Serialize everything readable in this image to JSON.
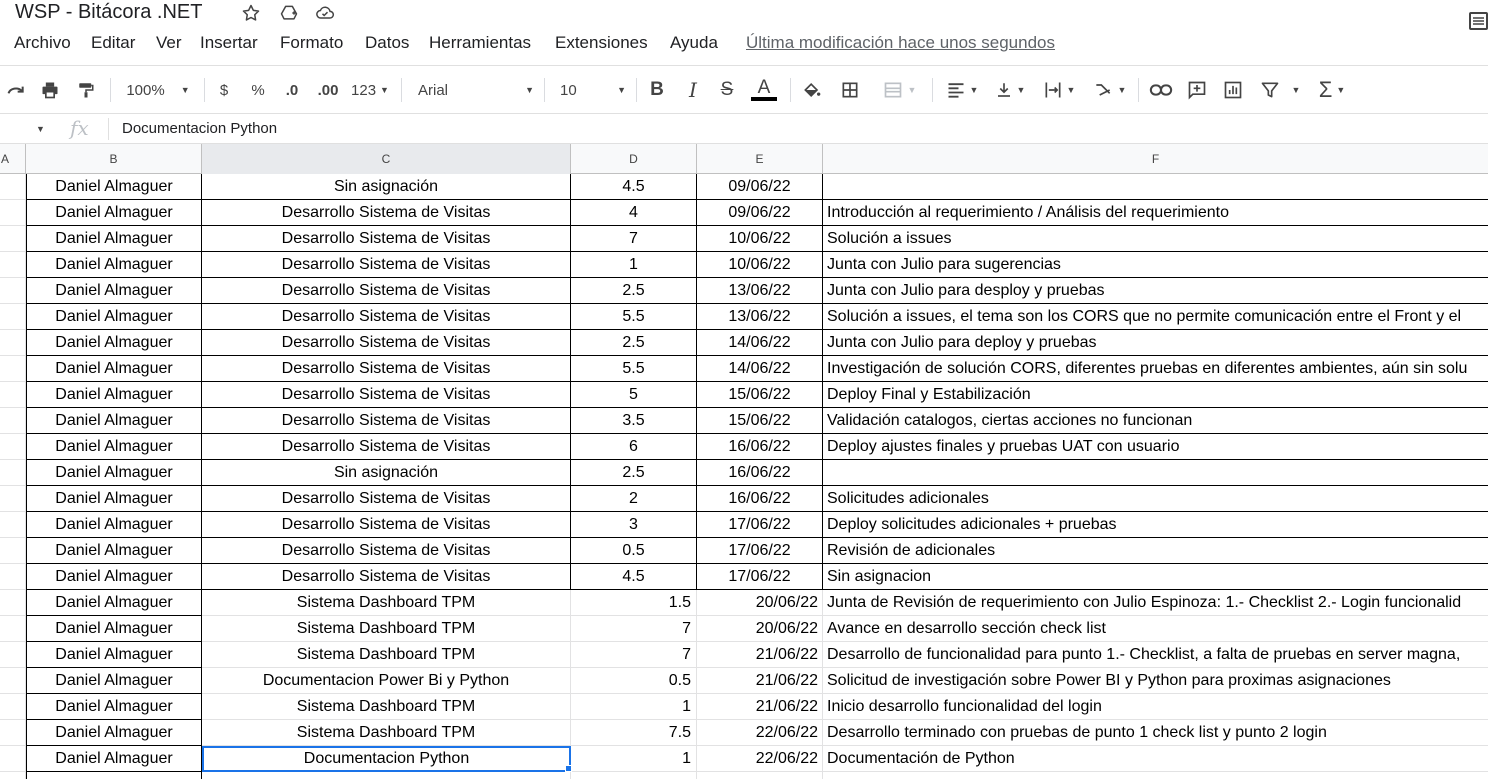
{
  "app": {
    "doc_title": "WSP - Bitácora .NET",
    "last_edit": "Última modificación hace unos segundos"
  },
  "menu": [
    "Archivo",
    "Editar",
    "Ver",
    "Insertar",
    "Formato",
    "Datos",
    "Herramientas",
    "Extensiones",
    "Ayuda"
  ],
  "toolbar": {
    "zoom": "100%",
    "currency": "$",
    "percent": "%",
    "dec_decrease": ".0",
    "dec_increase": ".00",
    "format_more": "123",
    "font": "Arial",
    "font_size": "10",
    "bold": "B",
    "italic": "I",
    "strike": "S",
    "text_color": "A"
  },
  "formula_bar": {
    "fx": "fx",
    "value": "Documentacion Python"
  },
  "columns": [
    "A",
    "B",
    "C",
    "D",
    "E",
    "F"
  ],
  "rows": [
    {
      "b": "Daniel Almaguer",
      "c": "Sin asignación",
      "d": "4.5",
      "e": "09/06/22",
      "f": ""
    },
    {
      "b": "Daniel Almaguer",
      "c": "Desarrollo Sistema de Visitas",
      "d": "4",
      "e": "09/06/22",
      "f": "Introducción al requerimiento / Análisis del requerimiento"
    },
    {
      "b": "Daniel Almaguer",
      "c": "Desarrollo Sistema de Visitas",
      "d": "7",
      "e": "10/06/22",
      "f": "Solución a issues"
    },
    {
      "b": "Daniel Almaguer",
      "c": "Desarrollo Sistema de Visitas",
      "d": "1",
      "e": "10/06/22",
      "f": "Junta con Julio para sugerencias"
    },
    {
      "b": "Daniel Almaguer",
      "c": "Desarrollo Sistema de Visitas",
      "d": "2.5",
      "e": "13/06/22",
      "f": "Junta con Julio para desploy y pruebas"
    },
    {
      "b": "Daniel Almaguer",
      "c": "Desarrollo Sistema de Visitas",
      "d": "5.5",
      "e": "13/06/22",
      "f": "Solución a issues, el tema son los CORS que no permite comunicación entre el Front y el"
    },
    {
      "b": "Daniel Almaguer",
      "c": "Desarrollo Sistema de Visitas",
      "d": "2.5",
      "e": "14/06/22",
      "f": "Junta con Julio para deploy y pruebas"
    },
    {
      "b": "Daniel Almaguer",
      "c": "Desarrollo Sistema de Visitas",
      "d": "5.5",
      "e": "14/06/22",
      "f": "Investigación de solución CORS, diferentes pruebas en diferentes ambientes, aún sin solu"
    },
    {
      "b": "Daniel Almaguer",
      "c": "Desarrollo Sistema de Visitas",
      "d": "5",
      "e": "15/06/22",
      "f": "Deploy Final y Estabilización"
    },
    {
      "b": "Daniel Almaguer",
      "c": "Desarrollo Sistema de Visitas",
      "d": "3.5",
      "e": "15/06/22",
      "f": "Validación catalogos, ciertas acciones no funcionan"
    },
    {
      "b": "Daniel Almaguer",
      "c": "Desarrollo Sistema de Visitas",
      "d": "6",
      "e": "16/06/22",
      "f": "Deploy ajustes finales y pruebas UAT con usuario"
    },
    {
      "b": "Daniel Almaguer",
      "c": "Sin asignación",
      "d": "2.5",
      "e": "16/06/22",
      "f": ""
    },
    {
      "b": "Daniel Almaguer",
      "c": "Desarrollo Sistema de Visitas",
      "d": "2",
      "e": "16/06/22",
      "f": "Solicitudes adicionales"
    },
    {
      "b": "Daniel Almaguer",
      "c": "Desarrollo Sistema de Visitas",
      "d": "3",
      "e": "17/06/22",
      "f": "Deploy solicitudes adicionales + pruebas"
    },
    {
      "b": "Daniel Almaguer",
      "c": "Desarrollo Sistema de Visitas",
      "d": "0.5",
      "e": "17/06/22",
      "f": "Revisión de adicionales"
    },
    {
      "b": "Daniel Almaguer",
      "c": "Desarrollo Sistema de Visitas",
      "d": "4.5",
      "e": "17/06/22",
      "f": "Sin asignacion"
    },
    {
      "b": "Daniel Almaguer",
      "c": "Sistema Dashboard TPM",
      "d": "1.5",
      "e": "20/06/22",
      "f": "Junta de Revisión de requerimiento con Julio Espinoza: 1.- Checklist 2.- Login funcionalid",
      "plain": true
    },
    {
      "b": "Daniel Almaguer",
      "c": "Sistema Dashboard TPM",
      "d": "7",
      "e": "20/06/22",
      "f": "Avance en desarrollo sección check list",
      "plain": true
    },
    {
      "b": "Daniel Almaguer",
      "c": "Sistema Dashboard TPM",
      "d": "7",
      "e": "21/06/22",
      "f": "Desarrollo de funcionalidad para punto 1.- Checklist, a falta de pruebas en server magna,",
      "plain": true
    },
    {
      "b": "Daniel Almaguer",
      "c": "Documentacion Power Bi y Python",
      "d": "0.5",
      "e": "21/06/22",
      "f": "Solicitud de investigación sobre Power BI y Python para proximas asignaciones",
      "plain": true
    },
    {
      "b": "Daniel Almaguer",
      "c": "Sistema Dashboard TPM",
      "d": "1",
      "e": "21/06/22",
      "f": "Inicio desarrollo funcionalidad del login",
      "plain": true
    },
    {
      "b": "Daniel Almaguer",
      "c": "Sistema Dashboard TPM",
      "d": "7.5",
      "e": "22/06/22",
      "f": "Desarrollo terminado con pruebas de punto 1 check list y punto 2 login",
      "plain": true
    },
    {
      "b": "Daniel Almaguer",
      "c": "Documentacion Python",
      "d": "1",
      "e": "22/06/22",
      "f": "Documentación de Python",
      "plain": true,
      "selected": true
    },
    {
      "b": "",
      "c": "",
      "d": "",
      "e": "",
      "f": "",
      "plain": true
    }
  ],
  "colors": {
    "selection": "#1a73e8",
    "header_bg": "#f8f9fa",
    "gridline": "#e2e2e3"
  }
}
